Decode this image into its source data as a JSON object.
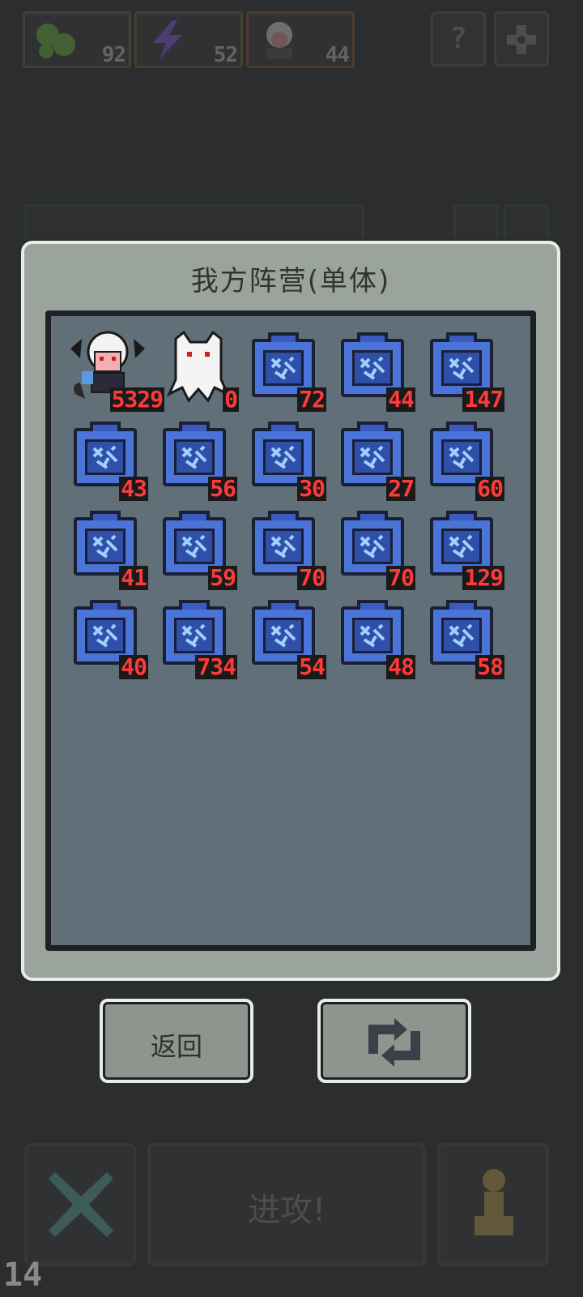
{
  "top": {
    "resources": [
      {
        "icon": "green-blob-icon",
        "count": "92"
      },
      {
        "icon": "lightning-icon",
        "count": "52"
      },
      {
        "icon": "demon-portrait-icon",
        "count": "44"
      }
    ],
    "help_label": "?",
    "settings_icon": "gear-icon"
  },
  "modal": {
    "title": "我方阵营(单体)",
    "units": [
      {
        "type": "hero",
        "icon": "white-haired-demon-icon",
        "value": "5329"
      },
      {
        "type": "ghost",
        "icon": "white-ghost-icon",
        "value": "0"
      },
      {
        "type": "box",
        "icon": "blue-supply-box-icon",
        "value": "72"
      },
      {
        "type": "box",
        "icon": "blue-supply-box-icon",
        "value": "44"
      },
      {
        "type": "box",
        "icon": "blue-supply-box-icon",
        "value": "147"
      },
      {
        "type": "box",
        "icon": "blue-supply-box-icon",
        "value": "43"
      },
      {
        "type": "box",
        "icon": "blue-supply-box-icon",
        "value": "56"
      },
      {
        "type": "box",
        "icon": "blue-supply-box-icon",
        "value": "30"
      },
      {
        "type": "box",
        "icon": "blue-supply-box-icon",
        "value": "27"
      },
      {
        "type": "box",
        "icon": "blue-supply-box-icon",
        "value": "60"
      },
      {
        "type": "box",
        "icon": "blue-supply-box-icon",
        "value": "41"
      },
      {
        "type": "box",
        "icon": "blue-supply-box-icon",
        "value": "59"
      },
      {
        "type": "box",
        "icon": "blue-supply-box-icon",
        "value": "70"
      },
      {
        "type": "box",
        "icon": "blue-supply-box-icon",
        "value": "70"
      },
      {
        "type": "box",
        "icon": "blue-supply-box-icon",
        "value": "129"
      },
      {
        "type": "box",
        "icon": "blue-supply-box-icon",
        "value": "40"
      },
      {
        "type": "box",
        "icon": "blue-supply-box-icon",
        "value": "734"
      },
      {
        "type": "box",
        "icon": "blue-supply-box-icon",
        "value": "54"
      },
      {
        "type": "box",
        "icon": "blue-supply-box-icon",
        "value": "48"
      },
      {
        "type": "box",
        "icon": "blue-supply-box-icon",
        "value": "58"
      }
    ]
  },
  "buttons": {
    "back_label": "返回",
    "refresh_icon": "swap-arrows-icon"
  },
  "bottom": {
    "cancel_icon": "x-icon",
    "attack_label": "进攻!",
    "pawn_icon": "pawn-icon",
    "level": "14"
  },
  "colors": {
    "background": "#2c2d2f",
    "modal": "#9aa39c",
    "inner_panel": "#616f78",
    "box_blue": "#4a74d8",
    "number_red": "#ff3a3a"
  }
}
